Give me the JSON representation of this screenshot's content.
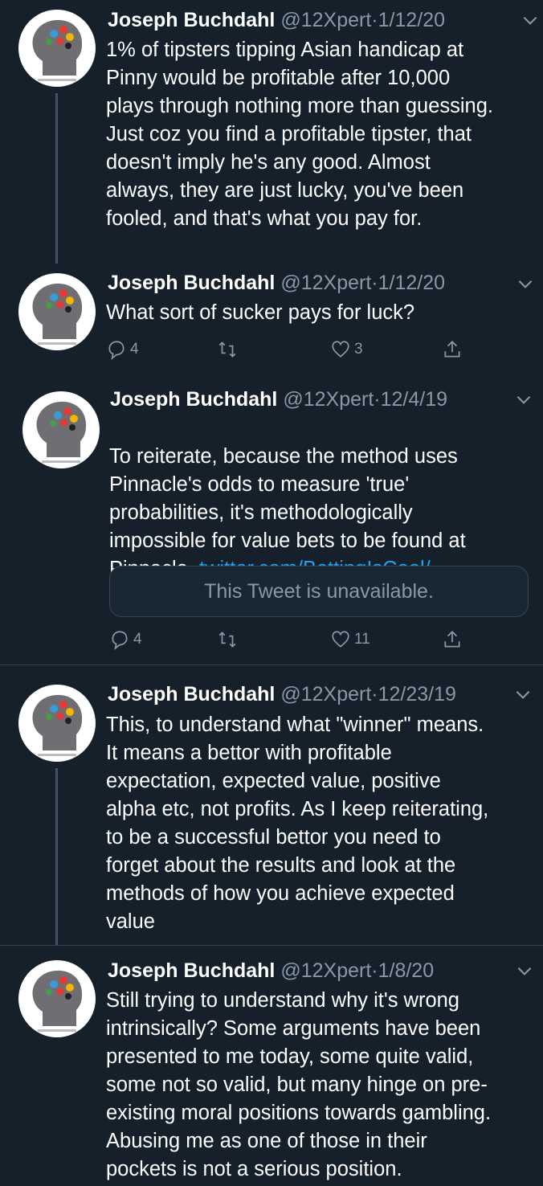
{
  "author": {
    "name": "Joseph Buchdahl",
    "handle": "@12Xpert",
    "separator": "·"
  },
  "tweets": [
    {
      "date": "1/12/20",
      "text": "1% of tipsters tipping Asian handicap at\nPinny would be profitable after 10,000\nplays through nothing more than guessing.\nJust coz you find a profitable tipster, that\ndoesn't imply he's any good. Almost\nalways, they are just lucky, you've been\nfooled, and that's what you pay for."
    },
    {
      "date": "1/12/20",
      "text": "What sort of sucker pays for luck?",
      "replies": "4",
      "likes": "3"
    },
    {
      "date": "12/4/19",
      "text": "To reiterate, because the method uses\nPinnacle's odds to measure 'true'\nprobabilities, it's methodologically\nimpossible for value bets to be found at\nPinnacle. ",
      "link": "twitter.com/BettingIsCool/...",
      "quote": "This Tweet is unavailable.",
      "replies": "4",
      "likes": "11"
    },
    {
      "date": "12/23/19",
      "text": "This, to understand what \"winner\" means.\nIt means a bettor with profitable\nexpectation, expected value, positive\nalpha etc, not profits. As I keep reiterating,\nto be a successful bettor you need to\nforget about the results and look at the\nmethods of how you achieve expected\nvalue"
    },
    {
      "date": "1/8/20",
      "text": "Still trying to understand why it's wrong\nintrinsically? Some arguments have been\npresented to me today, some quite valid,\nsome not so valid, but many hinge on pre-\nexisting moral positions towards gambling.\nAbusing me as one of those in their\npockets is not a serious position."
    }
  ]
}
